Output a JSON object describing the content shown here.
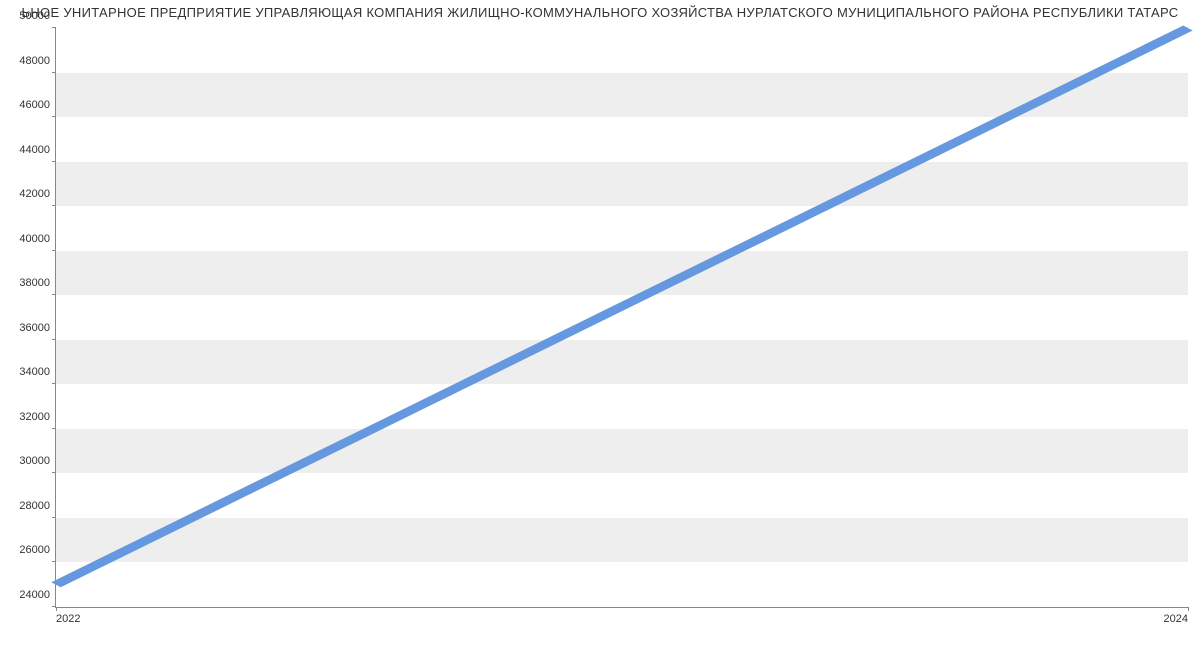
{
  "chart_data": {
    "type": "line",
    "title": "ЬНОЕ УНИТАРНОЕ ПРЕДПРИЯТИЕ УПРАВЛЯЮЩАЯ КОМПАНИЯ ЖИЛИЩНО-КОММУНАЛЬНОГО ХОЗЯЙСТВА НУРЛАТСКОГО МУНИЦИПАЛЬНОГО РАЙОНА РЕСПУБЛИКИ ТАТАРС",
    "x": [
      2022,
      2024
    ],
    "values": [
      25000,
      50000
    ],
    "x_ticks": [
      "2022",
      "2024"
    ],
    "y_ticks": [
      "24000",
      "26000",
      "28000",
      "30000",
      "32000",
      "34000",
      "36000",
      "38000",
      "40000",
      "42000",
      "44000",
      "46000",
      "48000",
      "50000"
    ],
    "ylim": [
      24000,
      50000
    ],
    "xlabel": "",
    "ylabel": "",
    "line_color": "#6698e0"
  }
}
